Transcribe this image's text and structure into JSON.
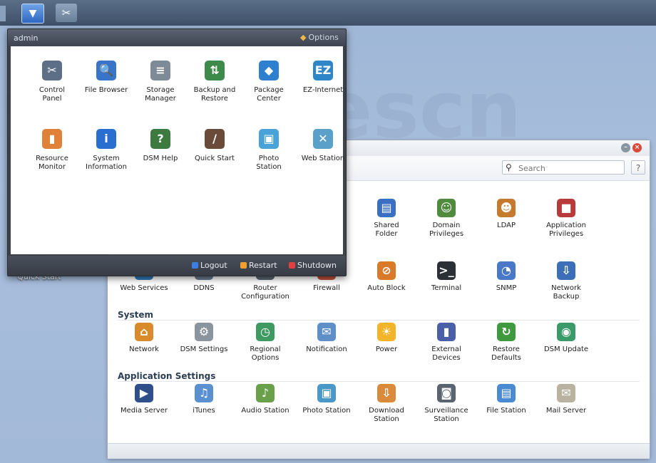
{
  "taskbar": {
    "menu_icon": "chevron-down-icon",
    "cp_icon": "tools-icon"
  },
  "background_text": "pisonajescn",
  "main_menu": {
    "user": "admin",
    "options_label": "Options",
    "items": [
      {
        "label": "Control\nPanel",
        "icon": "tools-icon",
        "color": "#5c6f86",
        "glyph": "✂"
      },
      {
        "label": "File Browser",
        "icon": "folder-search-icon",
        "color": "#3a74c8",
        "glyph": "🔍"
      },
      {
        "label": "Storage\nManager",
        "icon": "database-icon",
        "color": "#7f8a97",
        "glyph": "≡"
      },
      {
        "label": "Backup and\nRestore",
        "icon": "backup-icon",
        "color": "#3d8a4b",
        "glyph": "⇅"
      },
      {
        "label": "Package\nCenter",
        "icon": "package-icon",
        "color": "#2f7fcf",
        "glyph": "◆"
      },
      {
        "label": "EZ-Internet",
        "icon": "ez-internet-icon",
        "color": "#2e86c8",
        "glyph": "EZ"
      },
      {
        "label": "Resource\nMonitor",
        "icon": "bar-chart-icon",
        "color": "#e0813a",
        "glyph": "▮"
      },
      {
        "label": "System\nInformation",
        "icon": "info-icon",
        "color": "#2a6fd0",
        "glyph": "i"
      },
      {
        "label": "DSM Help",
        "icon": "help-icon",
        "color": "#3d7a3f",
        "glyph": "?"
      },
      {
        "label": "Quick Start",
        "icon": "wand-icon",
        "color": "#6a4b3a",
        "glyph": "/"
      },
      {
        "label": "Photo\nStation",
        "icon": "photo-icon",
        "color": "#4aa3d8",
        "glyph": "▣"
      },
      {
        "label": "Web Station",
        "icon": "globe-icon",
        "color": "#5aa0c8",
        "glyph": "✕"
      }
    ],
    "footer": {
      "logout": "Logout",
      "restart": "Restart",
      "shutdown": "Shutdown",
      "logout_color": "#3c7fe0",
      "restart_color": "#f0a030",
      "shutdown_color": "#e04040"
    }
  },
  "desktop": {
    "quick_start_label": "Quick Start"
  },
  "control_panel": {
    "search_placeholder": "Search",
    "help_label": "?",
    "row1": [
      {
        "label": "Shared\nFolder",
        "icon": "shared-folder-icon",
        "color": "#3b6fc4",
        "glyph": "▤"
      },
      {
        "label": "Domain\nPrivileges",
        "icon": "domain-user-icon",
        "color": "#4f8a3d",
        "glyph": "☺"
      },
      {
        "label": "LDAP",
        "icon": "ldap-users-icon",
        "color": "#c67a2e",
        "glyph": "☻"
      },
      {
        "label": "Application\nPrivileges",
        "icon": "app-privileges-icon",
        "color": "#b83a3a",
        "glyph": "■"
      }
    ],
    "row2": [
      {
        "label": "Web Services",
        "icon": "globe-icon",
        "color": "#2f7ab8",
        "glyph": "●"
      },
      {
        "label": "DDNS",
        "icon": "ddns-icon",
        "color": "#6a7b8d",
        "glyph": "⇄"
      },
      {
        "label": "Router\nConfiguration",
        "icon": "router-icon",
        "color": "#5b6672",
        "glyph": "▭"
      },
      {
        "label": "Firewall",
        "icon": "firewall-icon",
        "color": "#c0503a",
        "glyph": "▦"
      },
      {
        "label": "Auto Block",
        "icon": "auto-block-icon",
        "color": "#d9792a",
        "glyph": "⊘"
      },
      {
        "label": "Terminal",
        "icon": "terminal-icon",
        "color": "#2b3036",
        "glyph": ">_"
      },
      {
        "label": "SNMP",
        "icon": "snmp-icon",
        "color": "#4a78c8",
        "glyph": "◔"
      },
      {
        "label": "Network\nBackup",
        "icon": "network-backup-icon",
        "color": "#3d6fb8",
        "glyph": "⇩"
      }
    ],
    "system_title": "System",
    "system": [
      {
        "label": "Network",
        "icon": "home-icon",
        "color": "#d98a2a",
        "glyph": "⌂"
      },
      {
        "label": "DSM Settings",
        "icon": "gear-icon",
        "color": "#8a949e",
        "glyph": "⚙"
      },
      {
        "label": "Regional\nOptions",
        "icon": "clock-icon",
        "color": "#3f9a62",
        "glyph": "◷"
      },
      {
        "label": "Notification",
        "icon": "notification-icon",
        "color": "#5f8fc8",
        "glyph": "✉"
      },
      {
        "label": "Power",
        "icon": "lightbulb-icon",
        "color": "#f2b52a",
        "glyph": "☀"
      },
      {
        "label": "External\nDevices",
        "icon": "external-device-icon",
        "color": "#4a5fa8",
        "glyph": "▮"
      },
      {
        "label": "Restore\nDefaults",
        "icon": "restore-icon",
        "color": "#3f9a3f",
        "glyph": "↻"
      },
      {
        "label": "DSM Update",
        "icon": "update-icon",
        "color": "#3a9a6a",
        "glyph": "◉"
      }
    ],
    "apps_title": "Application Settings",
    "apps": [
      {
        "label": "Media Server",
        "icon": "media-server-icon",
        "color": "#2f4f8a",
        "glyph": "▶"
      },
      {
        "label": "iTunes",
        "icon": "itunes-icon",
        "color": "#5a8fd0",
        "glyph": "♫"
      },
      {
        "label": "Audio Station",
        "icon": "audio-station-icon",
        "color": "#6aa04a",
        "glyph": "♪"
      },
      {
        "label": "Photo Station",
        "icon": "photo-station-icon",
        "color": "#4a98c8",
        "glyph": "▣"
      },
      {
        "label": "Download\nStation",
        "icon": "download-station-icon",
        "color": "#d98a3a",
        "glyph": "⇩"
      },
      {
        "label": "Surveillance\nStation",
        "icon": "camera-icon",
        "color": "#5a6470",
        "glyph": "◙"
      },
      {
        "label": "File Station",
        "icon": "file-station-icon",
        "color": "#4a8ad0",
        "glyph": "▤"
      },
      {
        "label": "Mail Server",
        "icon": "mail-icon",
        "color": "#b8b2a0",
        "glyph": "✉"
      }
    ]
  }
}
